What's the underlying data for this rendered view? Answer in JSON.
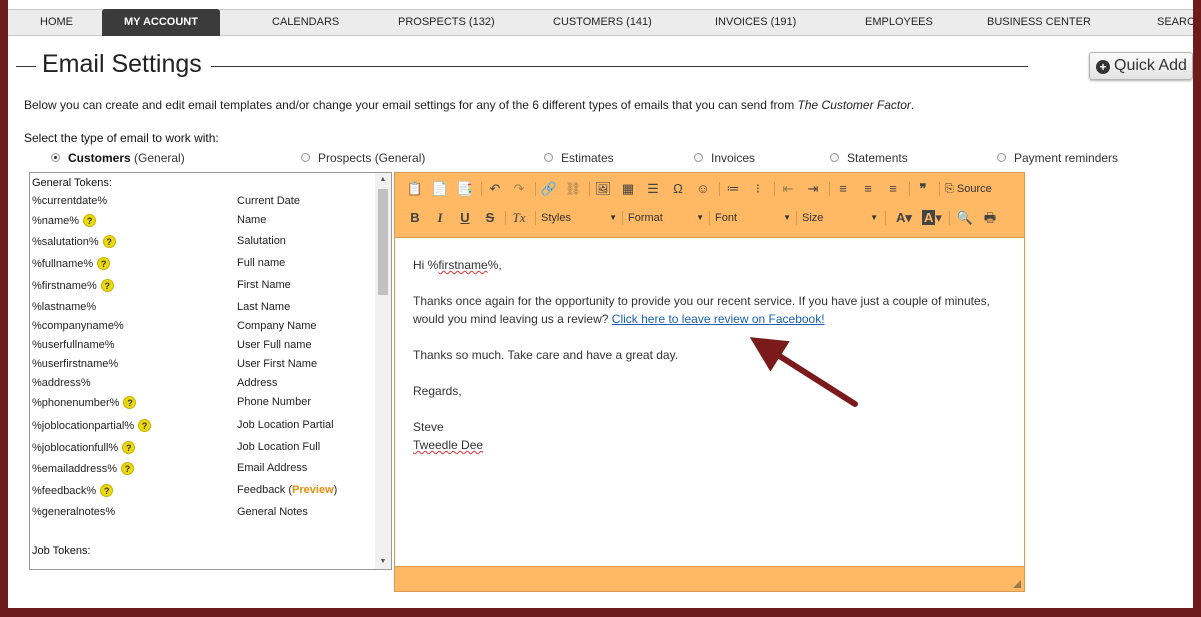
{
  "nav": {
    "items": [
      {
        "label": "Home",
        "count": ""
      },
      {
        "label": "My Account",
        "count": ""
      },
      {
        "label": "Calendars",
        "count": ""
      },
      {
        "label": "Prospects",
        "count": "(132)"
      },
      {
        "label": "Customers",
        "count": "(141)"
      },
      {
        "label": "Invoices",
        "count": "(191)"
      },
      {
        "label": "Employees",
        "count": ""
      },
      {
        "label": "Business Center",
        "count": ""
      },
      {
        "label": "Search",
        "count": ""
      }
    ],
    "active": "My Account"
  },
  "page": {
    "title": "Email Settings",
    "quick_add": "Quick Add",
    "intro": "Below you can create and edit email templates and/or change your email settings for any of the 6 different types of emails that you can send from ",
    "intro_brand": "The Customer Factor",
    "intro_end": ".",
    "select_label": "Select the type of email to work with:"
  },
  "email_types": [
    {
      "label": "Customers",
      "sub": "(General)",
      "selected": true
    },
    {
      "label": "Prospects (General)",
      "sub": "",
      "selected": false
    },
    {
      "label": "Estimates",
      "sub": "",
      "selected": false
    },
    {
      "label": "Invoices",
      "sub": "",
      "selected": false
    },
    {
      "label": "Statements",
      "sub": "",
      "selected": false
    },
    {
      "label": "Payment reminders",
      "sub": "",
      "selected": false
    }
  ],
  "tokens": {
    "general_header": "General Tokens:",
    "job_header": "Job Tokens:",
    "help_glyph": "?",
    "preview_label": "Preview",
    "general": [
      {
        "token": "%currentdate%",
        "desc": "Current Date",
        "help": false
      },
      {
        "token": "%name%",
        "desc": "Name",
        "help": true
      },
      {
        "token": "%salutation%",
        "desc": "Salutation",
        "help": true
      },
      {
        "token": "%fullname%",
        "desc": "Full name",
        "help": true
      },
      {
        "token": "%firstname%",
        "desc": "First Name",
        "help": true
      },
      {
        "token": "%lastname%",
        "desc": "Last Name",
        "help": false
      },
      {
        "token": "%companyname%",
        "desc": "Company Name",
        "help": false
      },
      {
        "token": "%userfullname%",
        "desc": "User Full name",
        "help": false
      },
      {
        "token": "%userfirstname%",
        "desc": "User First Name",
        "help": false
      },
      {
        "token": "%address%",
        "desc": "Address",
        "help": false
      },
      {
        "token": "%phonenumber%",
        "desc": "Phone Number",
        "help": true
      },
      {
        "token": "%joblocationpartial%",
        "desc": "Job Location Partial",
        "help": true
      },
      {
        "token": "%joblocationfull%",
        "desc": "Job Location Full",
        "help": true
      },
      {
        "token": "%emailaddress%",
        "desc": "Email Address",
        "help": true
      },
      {
        "token": "%feedback%",
        "desc": "Feedback",
        "help": true
      },
      {
        "token": "%generalnotes%",
        "desc": "General Notes",
        "help": false
      }
    ]
  },
  "editor": {
    "toolbar": {
      "source": "Source",
      "styles": "Styles",
      "format": "Format",
      "font": "Font",
      "size": "Size"
    },
    "body": {
      "greeting": "Hi %firstname%,",
      "para1_line1": "Thanks once again for the opportunity to provide you our recent service. If you have just a couple of minutes,",
      "para1_line2": "would you mind leaving us a review? ",
      "link": "Click here to leave review on Facebook!",
      "para2": "Thanks so much. Take care and have a great day.",
      "closing": "Regards,",
      "sig1": "Steve",
      "sig2": "Tweedle Dee"
    }
  },
  "colors": {
    "frame": "#6e1b1b",
    "editor_toolbar": "#ffb964",
    "arrow": "#7a1a1a",
    "help_badge": "#ecd90c",
    "preview": "#e08e0b"
  }
}
